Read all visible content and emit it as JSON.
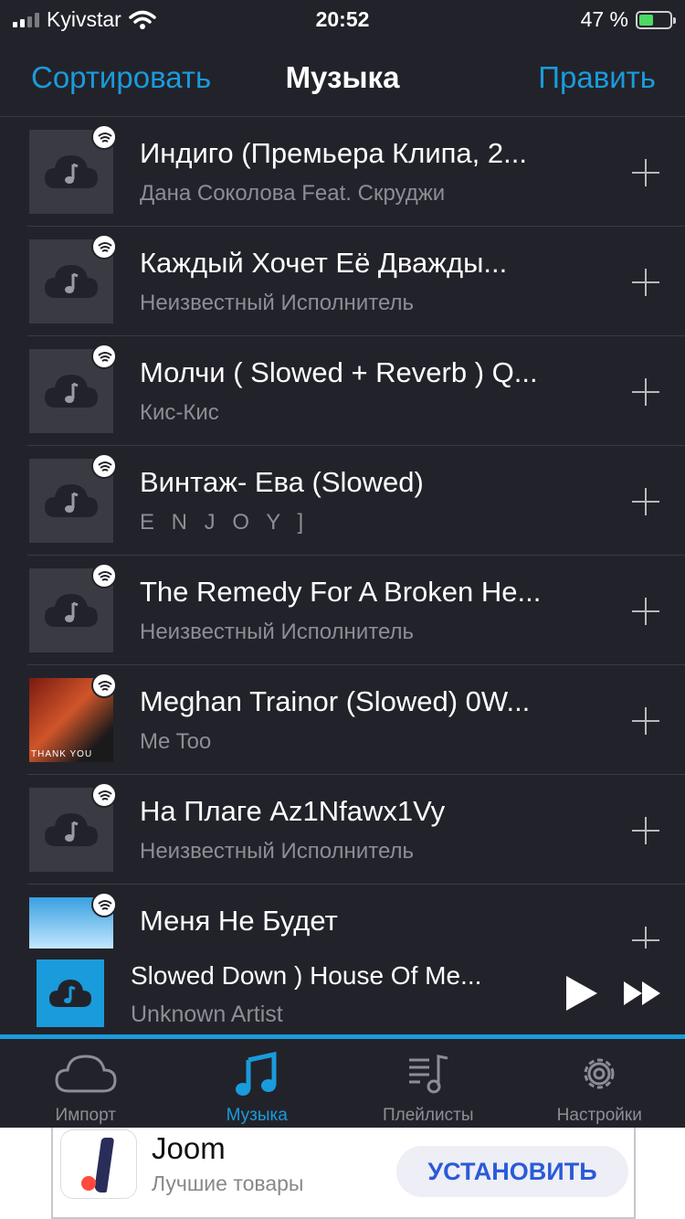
{
  "status_bar": {
    "carrier": "Kyivstar",
    "time": "20:52",
    "battery_text": "47 %",
    "battery_level": 0.47
  },
  "nav": {
    "left": "Сортировать",
    "title": "Музыка",
    "right": "Править"
  },
  "tracks": [
    {
      "title": "Индиго (Премьера Клипа, 2...",
      "artist": "Дана Соколова Feat. Скруджи",
      "art": "cloud"
    },
    {
      "title": "Каждый Хочет Её Дважды...",
      "artist": "Неизвестный Исполнитель",
      "art": "cloud"
    },
    {
      "title": "Молчи ( Slowed + Reverb ) Q...",
      "artist": "Кис-Кис",
      "art": "cloud"
    },
    {
      "title": "Винтаж- Ева (Slowed)",
      "artist": "E N J O Y ]",
      "art": "cloud"
    },
    {
      "title": "The Remedy For A Broken He...",
      "artist": "Неизвестный Исполнитель",
      "art": "cloud"
    },
    {
      "title": "Meghan Trainor (Slowed) 0W...",
      "artist": "Me Too",
      "art": "photo",
      "art_caption": "THANK YOU"
    },
    {
      "title": "На Плаге Az1Nfawx1Vy",
      "artist": "Неизвестный Исполнитель",
      "art": "cloud"
    },
    {
      "title": "Меня Не Будет",
      "artist": "",
      "art": "sky"
    }
  ],
  "now_playing": {
    "title": "Slowed Down ) House Of Me...",
    "artist": "Unknown Artist",
    "progress": 1.0
  },
  "tabs": [
    {
      "label": "Импорт",
      "icon": "cloud-icon",
      "active": false
    },
    {
      "label": "Музыка",
      "icon": "music-note-icon",
      "active": true
    },
    {
      "label": "Плейлисты",
      "icon": "playlist-icon",
      "active": false
    },
    {
      "label": "Настройки",
      "icon": "gear-icon",
      "active": false
    }
  ],
  "ad": {
    "title": "Joom",
    "subtitle": "Лучшие товары",
    "cta": "УСТАНОВИТЬ"
  },
  "colors": {
    "accent": "#1a9bdc",
    "background": "#22232a",
    "secondary_text": "#8d8e95"
  }
}
